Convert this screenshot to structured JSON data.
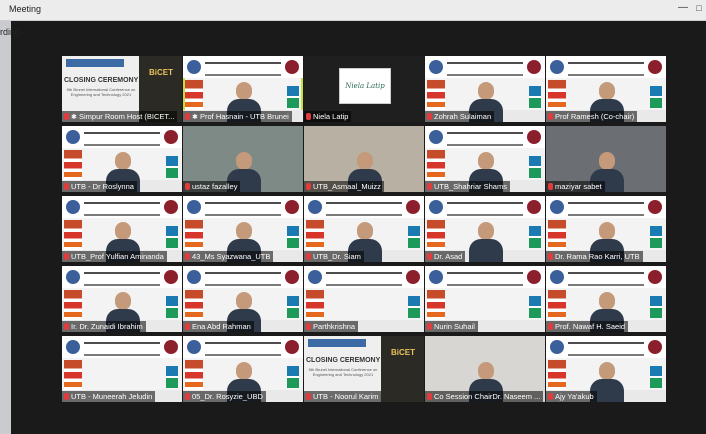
{
  "window": {
    "title": "Meeting",
    "minimize_glyph": "—",
    "maximize_glyph": "□"
  },
  "recording_text": "rding",
  "tiles": [
    {
      "name": "Simpur Room Host (BICET...",
      "kind": "closing",
      "pinned": true,
      "active": false,
      "closing_title": "CLOSING CEREMONY",
      "closing_sub": "5th Brunei International Conference on Engineering and Technology 2021",
      "brand": "BiCET"
    },
    {
      "name": "Prof Hasnain - UTB Brunei",
      "kind": "slide-person",
      "pinned": true,
      "active": true
    },
    {
      "name": "Niela Latip",
      "kind": "logo",
      "logo_text": "Niela Latip",
      "active": false
    },
    {
      "name": "Zohrah Sulaiman",
      "kind": "slide-person",
      "active": false
    },
    {
      "name": "Prof Ramesh (Co-chair)",
      "kind": "slide-person",
      "active": false
    },
    {
      "name": "UTB - Dr Roslynna",
      "kind": "slide-person",
      "active": false
    },
    {
      "name": "ustaz fazalley",
      "kind": "photo",
      "photo_color": "#7d8a86",
      "active": false
    },
    {
      "name": "UTB_Asmaal_Muizz",
      "kind": "photo",
      "photo_color": "#b8b1a3",
      "active": false
    },
    {
      "name": "UTB_Shahriar Shams",
      "kind": "slide-person",
      "active": false
    },
    {
      "name": "maziyar sabet",
      "kind": "photo",
      "photo_color": "#6b6f74",
      "active": false
    },
    {
      "name": "UTB_Prof Yulfian Aminanda",
      "kind": "slide-person",
      "active": false
    },
    {
      "name": "43_Ms Syazwana_UTB",
      "kind": "slide-person",
      "active": false
    },
    {
      "name": "UTB_Dr. Siam",
      "kind": "slide-person",
      "active": false
    },
    {
      "name": "Dr. Asad",
      "kind": "slide-person",
      "active": false
    },
    {
      "name": "Dr. Rama Rao Karri, UTB",
      "kind": "slide-person",
      "active": false
    },
    {
      "name": "Ir. Dr. Zunaidi Ibrahim",
      "kind": "slide-person",
      "active": false
    },
    {
      "name": "Ena Abd Rahman",
      "kind": "slide-person",
      "active": false
    },
    {
      "name": "Parthkrishna",
      "kind": "slide",
      "active": false
    },
    {
      "name": "Nurin Suhail",
      "kind": "slide",
      "active": false
    },
    {
      "name": "Prof. Nawaf H. Saeid",
      "kind": "slide-person",
      "active": false
    },
    {
      "name": "UTB - Muneerah Jeludin",
      "kind": "slide",
      "active": false
    },
    {
      "name": "05_Dr. Rosyzie_UBD",
      "kind": "slide-person",
      "active": false
    },
    {
      "name": "UTB - Noorul Karim",
      "kind": "closing",
      "active": false,
      "closing_title": "CLOSING CEREMONY",
      "closing_sub": "5th Brunei International Conference on Engineering and Technology 2021",
      "brand": "BiCET"
    },
    {
      "name": "Co Session ChairDr. Naseem ...",
      "kind": "photo",
      "photo_color": "#d8d6d2",
      "active": false
    },
    {
      "name": "Ajy Ya'akub",
      "kind": "slide-person",
      "active": false
    }
  ]
}
